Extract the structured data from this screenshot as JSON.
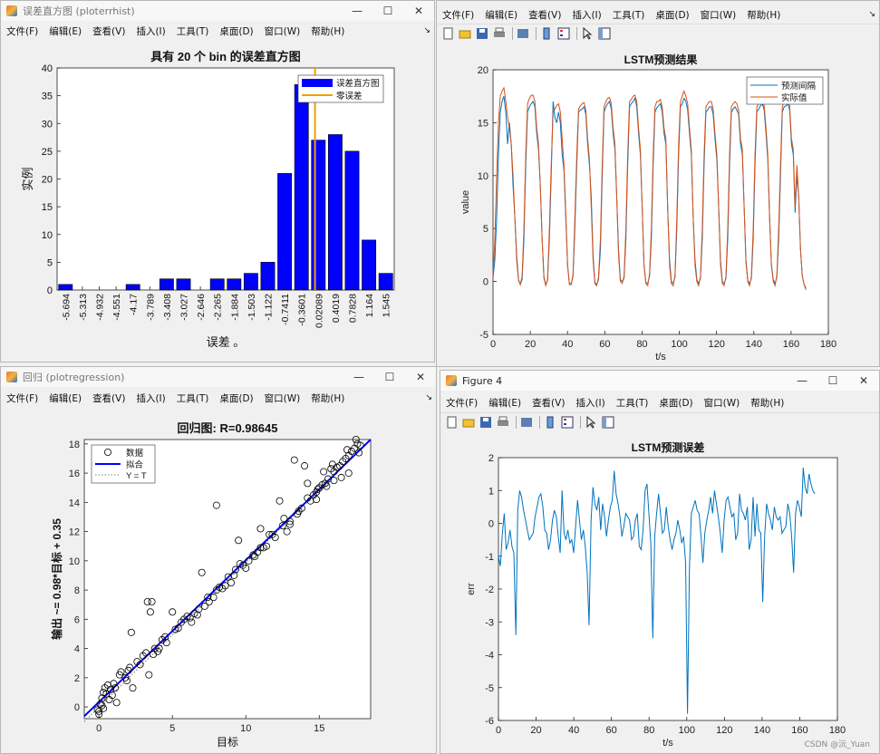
{
  "windows": {
    "hist": {
      "title": "误差直方图 (ploterrhist)",
      "menus": [
        "文件(F)",
        "编辑(E)",
        "查看(V)",
        "插入(I)",
        "工具(T)",
        "桌面(D)",
        "窗口(W)",
        "帮助(H)"
      ]
    },
    "pred": {
      "menus": [
        "文件(F)",
        "编辑(E)",
        "查看(V)",
        "插入(I)",
        "工具(T)",
        "桌面(D)",
        "窗口(W)",
        "帮助(H)"
      ]
    },
    "regr": {
      "title": "回归 (plotregression)",
      "menus": [
        "文件(F)",
        "编辑(E)",
        "查看(V)",
        "插入(I)",
        "工具(T)",
        "桌面(D)",
        "窗口(W)",
        "帮助(H)"
      ]
    },
    "err": {
      "title": "Figure 4",
      "menus": [
        "文件(F)",
        "编辑(E)",
        "查看(V)",
        "插入(I)",
        "工具(T)",
        "桌面(D)",
        "窗口(W)",
        "帮助(H)"
      ]
    }
  },
  "icons": {
    "minimize": "—",
    "maximize": "☐",
    "close": "✕",
    "menu_arrow": "↘"
  },
  "watermark": "CSDN @沅_Yuan",
  "chart_data": [
    {
      "id": "hist",
      "type": "bar",
      "title": "具有 20 个 bin 的误差直方图",
      "xlabel": "误差 。",
      "ylabel": "实例",
      "categories": [
        "-5.694",
        "-5.313",
        "-4.932",
        "-4.551",
        "-4.17",
        "-3.789",
        "-3.408",
        "-3.027",
        "-2.646",
        "-2.265",
        "-1.884",
        "-1.503",
        "-1.122",
        "-0.7411",
        "-0.3601",
        "0.02089",
        "0.4019",
        "0.7828",
        "1.164",
        "1.545"
      ],
      "values": [
        1,
        0,
        0,
        0,
        1,
        0,
        2,
        2,
        0,
        2,
        2,
        3,
        5,
        21,
        37,
        27,
        28,
        25,
        9,
        3
      ],
      "ylim": [
        0,
        40
      ],
      "yticks": [
        0,
        5,
        10,
        15,
        20,
        25,
        30,
        35,
        40
      ],
      "zero_line_index": 15.3,
      "legend": [
        "误差直方图",
        "零误差"
      ],
      "bar_color": "#0000ff",
      "zero_color": "#f0a000"
    },
    {
      "id": "pred",
      "type": "line",
      "title": "LSTM预测结果",
      "xlabel": "t/s",
      "ylabel": "value",
      "xlim": [
        0,
        180
      ],
      "ylim": [
        -5,
        20
      ],
      "xticks": [
        0,
        20,
        40,
        60,
        80,
        100,
        120,
        140,
        160,
        180
      ],
      "yticks": [
        -5,
        0,
        5,
        10,
        15,
        20
      ],
      "legend_position": "top-right",
      "series": [
        {
          "name": "预测间隔",
          "color": "#0072bd",
          "values": [
            0.3,
            2,
            6,
            12,
            16,
            17,
            17.5,
            16,
            13,
            15,
            13,
            9,
            6,
            2.5,
            0.2,
            -0.3,
            0.2,
            4,
            11,
            16,
            16.5,
            16.8,
            17,
            16.5,
            14,
            12.5,
            9,
            4,
            0.4,
            -0.3,
            0.1,
            4,
            10,
            17,
            15.5,
            15,
            16,
            15,
            12,
            10.5,
            6,
            1.5,
            -0.2,
            -0.2,
            0.5,
            5,
            11,
            16,
            16.2,
            16.3,
            16.5,
            15.8,
            13,
            11,
            8,
            2.5,
            -0.1,
            -0.3,
            0.2,
            3,
            10,
            16,
            16.5,
            16.8,
            17,
            16.3,
            14,
            12.5,
            8,
            3,
            0.2,
            0,
            0.3,
            4,
            11,
            16.5,
            16.8,
            17,
            17.3,
            16.5,
            14,
            12,
            7,
            1.6,
            -0.1,
            -0.2,
            0.5,
            4,
            11,
            16,
            16.4,
            16.6,
            16.8,
            16,
            14,
            13,
            7,
            2,
            0,
            -0.2,
            0.4,
            5,
            12,
            16.5,
            16.8,
            17.3,
            17,
            16.2,
            14,
            12,
            6,
            2,
            0.2,
            -0.2,
            0.3,
            4,
            11,
            16,
            16.2,
            16.5,
            16.5,
            15.8,
            13.5,
            11.5,
            7,
            2,
            0,
            -0.2,
            0.3,
            4,
            11,
            16,
            16.3,
            16.5,
            16.2,
            15.8,
            13,
            12,
            7,
            2,
            0.1,
            -0.2,
            0.3,
            4,
            11,
            16,
            16.3,
            16.6,
            16.8,
            16.2,
            14,
            11.5,
            6,
            1.6,
            0.2,
            -0.2,
            0.4,
            4,
            10,
            16,
            16.5,
            16.6,
            16.8,
            16.2,
            13,
            12,
            6.5,
            10,
            8,
            3,
            0.5,
            -0.3,
            -0.6
          ]
        },
        {
          "name": "实际值",
          "color": "#d95319",
          "values": [
            0.4,
            4,
            10,
            15,
            17.5,
            18,
            18.3,
            17,
            15.5,
            14.5,
            13,
            10,
            6,
            2,
            0.1,
            -0.3,
            0.5,
            5,
            12,
            16.8,
            17.3,
            17.6,
            17.6,
            17,
            14.5,
            13,
            9,
            4,
            0.3,
            -0.4,
            0.2,
            5,
            11,
            16,
            16.3,
            16.6,
            16.8,
            16,
            13.5,
            11,
            6.5,
            1.5,
            -0.3,
            -0.3,
            0.7,
            6,
            12,
            16.3,
            16.6,
            16.8,
            16.9,
            16.2,
            13.5,
            11.5,
            7,
            2,
            -0.2,
            -0.4,
            0.4,
            4,
            11,
            16.5,
            17,
            17.3,
            17.4,
            16.8,
            14.5,
            13,
            8,
            2.5,
            0,
            -0.2,
            0.5,
            5,
            12,
            17,
            17.2,
            17.5,
            17.6,
            17,
            14.5,
            12.5,
            7,
            1.5,
            -0.2,
            -0.4,
            0.7,
            5,
            12,
            16.5,
            17,
            17,
            17.2,
            16.5,
            14.5,
            13.5,
            7,
            1.5,
            -0.2,
            -0.4,
            0.6,
            6,
            13,
            17,
            17.5,
            18,
            17.5,
            16.8,
            14.5,
            12.5,
            6,
            1.5,
            0,
            -0.4,
            0.5,
            5,
            12,
            16.5,
            16.8,
            17,
            17,
            16.3,
            14,
            12,
            7,
            1.6,
            -0.2,
            -0.4,
            0.5,
            5,
            12,
            16.5,
            16.8,
            17,
            16.8,
            16.2,
            13.5,
            12.5,
            7,
            1.8,
            0,
            -0.4,
            0.5,
            5,
            12,
            16.5,
            16.8,
            17,
            17.2,
            16.6,
            14.5,
            12,
            6,
            1.5,
            0,
            -0.4,
            0.6,
            5,
            11,
            16.5,
            17,
            17,
            17.2,
            16.6,
            13.5,
            12.5,
            7,
            11,
            8,
            3,
            0.5,
            -0.3,
            -0.8
          ]
        }
      ]
    },
    {
      "id": "regr",
      "type": "scatter",
      "title": "回归图: R=0.98645",
      "xlabel": "目标",
      "ylabel": "输出 ~= 0.98*目标 + 0.35",
      "xlim": [
        -1,
        18.5
      ],
      "ylim": [
        -0.8,
        18.3
      ],
      "xticks": [
        0,
        5,
        10,
        15
      ],
      "yticks": [
        0,
        2,
        4,
        6,
        8,
        10,
        12,
        14,
        16,
        18
      ],
      "fit": {
        "slope": 0.98,
        "intercept": 0.35
      },
      "legend": [
        "数据",
        "拟合",
        "Y = T"
      ],
      "points": [
        [
          0,
          -0.3
        ],
        [
          0.1,
          0.2
        ],
        [
          0.2,
          0.6
        ],
        [
          0.3,
          1
        ],
        [
          0.4,
          1.3
        ],
        [
          0.5,
          0.9
        ],
        [
          0.3,
          -0.1
        ],
        [
          0.6,
          1.5
        ],
        [
          0.8,
          1.2
        ],
        [
          0,
          -0.5
        ],
        [
          -0.1,
          -0.2
        ],
        [
          0.9,
          0.8
        ],
        [
          1,
          1.6
        ],
        [
          1.2,
          0.3
        ],
        [
          1.4,
          2.2
        ],
        [
          1.5,
          2.4
        ],
        [
          1.8,
          2
        ],
        [
          2,
          2.5
        ],
        [
          2.1,
          2.7
        ],
        [
          2.2,
          5.1
        ],
        [
          2.3,
          1.3
        ],
        [
          2.6,
          3.1
        ],
        [
          3,
          3.5
        ],
        [
          3.2,
          3.7
        ],
        [
          3.3,
          7.2
        ],
        [
          3.5,
          6.5
        ],
        [
          3.6,
          7.2
        ],
        [
          3.4,
          2.2
        ],
        [
          3.8,
          4
        ],
        [
          4,
          3.8
        ],
        [
          4.3,
          4.6
        ],
        [
          4.5,
          4.8
        ],
        [
          5,
          6.5
        ],
        [
          5.4,
          5.4
        ],
        [
          5.6,
          5.8
        ],
        [
          6,
          6.2
        ],
        [
          6.3,
          5.8
        ],
        [
          6.5,
          6.4
        ],
        [
          6.7,
          6.3
        ],
        [
          7,
          9.2
        ],
        [
          7.2,
          6.9
        ],
        [
          7.5,
          7.2
        ],
        [
          7.8,
          7.5
        ],
        [
          8,
          13.8
        ],
        [
          8.2,
          8.2
        ],
        [
          8.4,
          8.1
        ],
        [
          8.6,
          8.3
        ],
        [
          9,
          8.5
        ],
        [
          9.2,
          9
        ],
        [
          9.5,
          11.4
        ],
        [
          9.8,
          9.7
        ],
        [
          10,
          9.5
        ],
        [
          10.2,
          10
        ],
        [
          10.5,
          10.4
        ],
        [
          10.8,
          10.6
        ],
        [
          11,
          12.2
        ],
        [
          11.2,
          10.9
        ],
        [
          11.4,
          11
        ],
        [
          11.8,
          11.8
        ],
        [
          12,
          11.6
        ],
        [
          12.3,
          14.1
        ],
        [
          12.5,
          12.4
        ],
        [
          12.8,
          12
        ],
        [
          13,
          12.7
        ],
        [
          13.3,
          16.9
        ],
        [
          13.5,
          13.2
        ],
        [
          13.8,
          13.6
        ],
        [
          14,
          16.5
        ],
        [
          14.2,
          15.3
        ],
        [
          14.4,
          14.1
        ],
        [
          14.6,
          14.5
        ],
        [
          14.8,
          14.7
        ],
        [
          15,
          15
        ],
        [
          15.2,
          15.2
        ],
        [
          15.4,
          15.3
        ],
        [
          15.6,
          15.6
        ],
        [
          15.8,
          16.3
        ],
        [
          16,
          16.1
        ],
        [
          16.2,
          16.4
        ],
        [
          16.4,
          16.5
        ],
        [
          16.6,
          16.8
        ],
        [
          16.8,
          17
        ],
        [
          17,
          17.2
        ],
        [
          17.2,
          17.5
        ],
        [
          17.4,
          17.7
        ],
        [
          17.6,
          18
        ],
        [
          17.7,
          17.4
        ],
        [
          17,
          16
        ],
        [
          16.5,
          15.7
        ],
        [
          16,
          15.5
        ],
        [
          15.5,
          15.1
        ],
        [
          14.8,
          14.2
        ],
        [
          14.2,
          14.3
        ],
        [
          13.6,
          13.4
        ],
        [
          13,
          12.5
        ],
        [
          12.6,
          12.9
        ],
        [
          11.6,
          11.8
        ],
        [
          11,
          10.9
        ],
        [
          10.6,
          10.3
        ],
        [
          9.6,
          9.8
        ],
        [
          9.3,
          9.4
        ],
        [
          8.8,
          8.9
        ],
        [
          8,
          8
        ],
        [
          7.4,
          7.5
        ],
        [
          6.8,
          6.7
        ],
        [
          6.2,
          6.1
        ],
        [
          5.8,
          6
        ],
        [
          5.2,
          5.3
        ],
        [
          4.6,
          4.4
        ],
        [
          4.1,
          4
        ],
        [
          3.7,
          3.6
        ],
        [
          2.8,
          2.9
        ],
        [
          1.9,
          1.8
        ],
        [
          1.1,
          1.3
        ],
        [
          0.7,
          0.5
        ],
        [
          0.2,
          0.1
        ],
        [
          17.5,
          18.3
        ],
        [
          17.8,
          17.9
        ],
        [
          16.9,
          17.6
        ],
        [
          15.9,
          16.6
        ],
        [
          14.9,
          14.9
        ],
        [
          15.3,
          16.1
        ]
      ]
    },
    {
      "id": "err",
      "type": "line",
      "title": "LSTM预测误差",
      "xlabel": "t/s",
      "ylabel": "err",
      "xlim": [
        0,
        180
      ],
      "ylim": [
        -6,
        2
      ],
      "xticks": [
        0,
        20,
        40,
        60,
        80,
        100,
        120,
        140,
        160,
        180
      ],
      "yticks": [
        -6,
        -5,
        -4,
        -3,
        -2,
        -1,
        0,
        1,
        2
      ],
      "series": [
        {
          "name": "",
          "color": "#0072bd",
          "values": [
            -1,
            -1.3,
            -0.3,
            0.3,
            -0.8,
            -0.6,
            -0.2,
            -0.7,
            -0.9,
            -3.4,
            0.4,
            1,
            0.8,
            0.4,
            0.1,
            -0.2,
            -0.5,
            -0.4,
            -0.3,
            0.2,
            0.5,
            0.8,
            0.9,
            0.5,
            -0.2,
            -0.3,
            -0.8,
            -0.5,
            0.1,
            0.4,
            0.2,
            -0.4,
            -0.9,
            1,
            -0.3,
            -0.5,
            -0.2,
            -0.6,
            -0.5,
            -0.9,
            -0.1,
            0.7,
            0.1,
            -0.5,
            -0.2,
            -0.7,
            -1.5,
            -3.1,
            0.1,
            1.1,
            0.6,
            0.4,
            0.8,
            -0.2,
            0.6,
            0.2,
            -0.4,
            0.1,
            0.5,
            0.7,
            1.6,
            0.9,
            0.6,
            0.2,
            -0.4,
            -0.1,
            0.3,
            0.2,
            0.1,
            -0.5,
            -0.4,
            0.1,
            0.3,
            -0.7,
            -0.8,
            -0.2,
            1,
            1.2,
            0.3,
            -0.6,
            -3.5,
            -0.4,
            0.3,
            0.9,
            0.3,
            -0.3,
            -0.2,
            0.5,
            -0.1,
            -0.5,
            -0.8,
            -0.5,
            -0.3,
            0.1,
            -0.2,
            -0.6,
            -0.4,
            -1.2,
            -5.8,
            -1.4,
            0.3,
            0.5,
            0.7,
            0.4,
            0.3,
            -0.4,
            -1.2,
            -0.3,
            0.1,
            0.4,
            0.8,
            0.3,
            1,
            0.6,
            0.2,
            -0.3,
            -0.9,
            0.1,
            0.7,
            0.8,
            0.5,
            0.2,
            0.3,
            -0.5,
            -0.3,
            0.9,
            0.4,
            0.3,
            0.1,
            0.5,
            -0.8,
            -0.5,
            0.8,
            -0.4,
            0.6,
            -0.2,
            -0.3,
            -2.4,
            -0.4,
            0.6,
            0.3,
            0.1,
            -0.2,
            0.5,
            0.2,
            0.1,
            0.2,
            -0.3,
            -0.2,
            -0.1,
            0.6,
            0.3,
            -0.4,
            -1.5,
            0.3,
            0.7,
            0.5,
            0.2,
            1.7,
            1.1,
            0.9,
            1.5,
            1.2,
            1,
            0.9
          ]
        }
      ]
    }
  ]
}
